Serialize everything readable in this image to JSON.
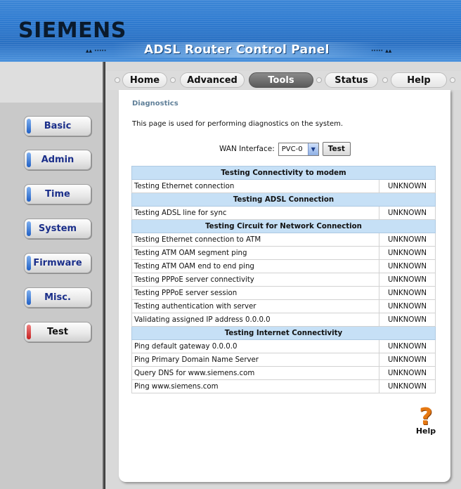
{
  "header": {
    "brand": "SIEMENS",
    "app_title": "ADSL Router Control Panel",
    "dots_left": "▴▴ ·····",
    "dots_right": "····· ▴▴"
  },
  "tabs": [
    {
      "label": "Home",
      "active": false
    },
    {
      "label": "Advanced",
      "active": false
    },
    {
      "label": "Tools",
      "active": true
    },
    {
      "label": "Status",
      "active": false
    },
    {
      "label": "Help",
      "active": false
    }
  ],
  "sidebar": {
    "items": [
      {
        "label": "Basic",
        "active": false
      },
      {
        "label": "Admin",
        "active": false
      },
      {
        "label": "Time",
        "active": false
      },
      {
        "label": "System",
        "active": false
      },
      {
        "label": "Firmware",
        "active": false
      },
      {
        "label": "Misc.",
        "active": false
      },
      {
        "label": "Test",
        "active": true
      }
    ]
  },
  "main": {
    "breadcrumb": "Diagnostics",
    "intro": "This page is used for performing diagnostics on the system.",
    "wan_label": "WAN Interface:",
    "wan_value": "PVC-0",
    "test_button": "Test",
    "table": [
      {
        "type": "head",
        "label": "Testing Connectivity to modem"
      },
      {
        "type": "row",
        "label": "Testing Ethernet connection",
        "status": "UNKNOWN"
      },
      {
        "type": "head",
        "label": "Testing ADSL Connection"
      },
      {
        "type": "row",
        "label": "Testing ADSL line for sync",
        "status": "UNKNOWN"
      },
      {
        "type": "head",
        "label": "Testing Circuit for Network Connection"
      },
      {
        "type": "row",
        "label": "Testing Ethernet connection to ATM",
        "status": "UNKNOWN"
      },
      {
        "type": "row",
        "label": "Testing ATM OAM segment ping",
        "status": "UNKNOWN"
      },
      {
        "type": "row",
        "label": "Testing ATM OAM end to end ping",
        "status": "UNKNOWN"
      },
      {
        "type": "row",
        "label": "Testing PPPoE server connectivity",
        "status": "UNKNOWN"
      },
      {
        "type": "row",
        "label": "Testing PPPoE server session",
        "status": "UNKNOWN"
      },
      {
        "type": "row",
        "label": "Testing authentication with server",
        "status": "UNKNOWN"
      },
      {
        "type": "row",
        "label": "Validating assigned IP address 0.0.0.0",
        "status": "UNKNOWN"
      },
      {
        "type": "head",
        "label": "Testing Internet Connectivity"
      },
      {
        "type": "row",
        "label": "Ping default gateway 0.0.0.0",
        "status": "UNKNOWN"
      },
      {
        "type": "row",
        "label": "Ping Primary Domain Name Server",
        "status": "UNKNOWN"
      },
      {
        "type": "row",
        "label": "Query DNS for www.siemens.com",
        "status": "UNKNOWN"
      },
      {
        "type": "row",
        "label": "Ping www.siemens.com",
        "status": "UNKNOWN"
      }
    ],
    "help_label": "Help",
    "help_icon": "?"
  }
}
